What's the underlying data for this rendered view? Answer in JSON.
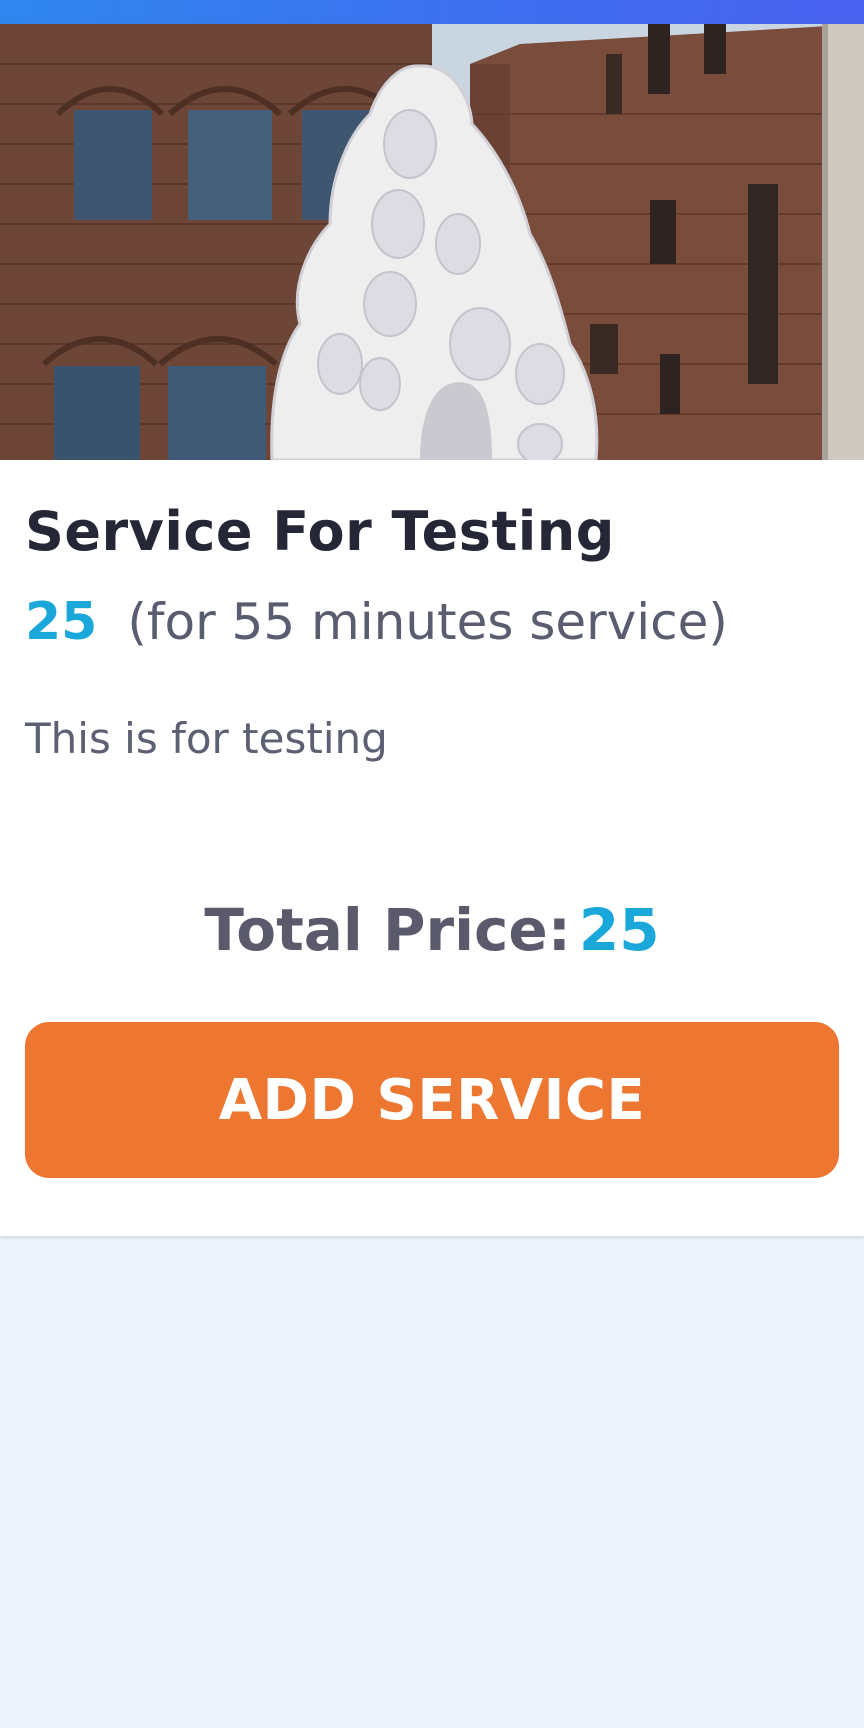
{
  "service": {
    "title": "Service For Testing",
    "price": "25",
    "duration_text": "(for 55 minutes service)",
    "description": "This is for testing"
  },
  "total": {
    "label": "Total Price:",
    "value": "25"
  },
  "actions": {
    "add_service_label": "ADD SERVICE"
  },
  "colors": {
    "accent_blue": "#1aa8db",
    "button_orange": "#ed7731",
    "page_background": "#eff3fb",
    "status_bar_gradient_start": "#2f86ee",
    "status_bar_gradient_end": "#4a62f0"
  },
  "image": {
    "subject": "white sculpture of carved faces in front of brick buildings"
  }
}
